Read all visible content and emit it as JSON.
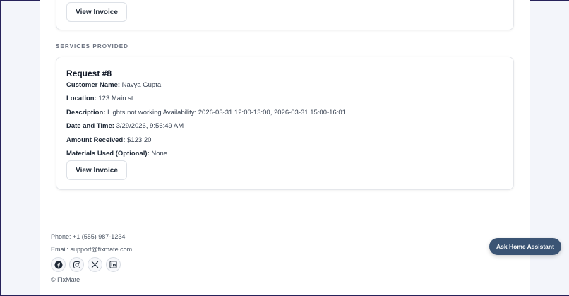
{
  "previous_card": {
    "button_label": "View Invoice"
  },
  "section_title": "SERVICES PROVIDED",
  "request": {
    "title": "Request #8",
    "fields": [
      {
        "label": "Customer Name:",
        "value": "Navya Gupta"
      },
      {
        "label": "Location:",
        "value": "123 Main st"
      },
      {
        "label": "Description:",
        "value": "Lights not working Availability: 2026-03-31 12:00-13:00, 2026-03-31 15:00-16:01"
      },
      {
        "label": "Date and Time:",
        "value": "3/29/2026, 9:56:49 AM"
      },
      {
        "label": "Amount Received:",
        "value": "$123.20"
      },
      {
        "label": "Materials Used (Optional):",
        "value": "None"
      }
    ],
    "button_label": "View Invoice"
  },
  "footer": {
    "phone": "Phone: +1 (555) 987-1234",
    "email": "Email: support@fixmate.com",
    "copyright": "© FixMate",
    "socials": [
      "facebook-icon",
      "instagram-icon",
      "x-icon",
      "linkedin-icon"
    ]
  },
  "assistant": {
    "label": "Ask Home Assistant"
  },
  "colors": {
    "accent": "#3b5474",
    "frame": "#26225a"
  }
}
